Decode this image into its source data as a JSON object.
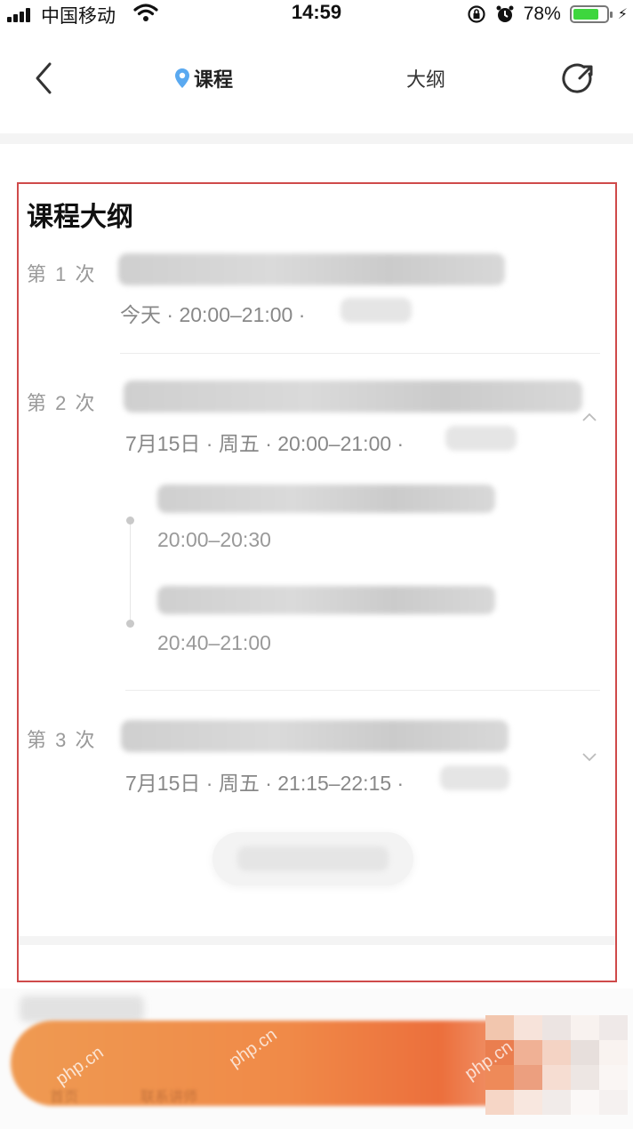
{
  "status_bar": {
    "carrier": "中国移动",
    "time": "14:59",
    "battery_percent": "78%",
    "battery_level": 0.78,
    "battery_color": "#3ed63e"
  },
  "nav": {
    "tab_course": "课程",
    "tab_outline": "大纲",
    "location_icon_color": "#5aa9f0"
  },
  "outline": {
    "title": "课程大纲",
    "lessons": [
      {
        "index": "第 1 次",
        "meta": "今天 · 20:00–21:00 ·"
      },
      {
        "index": "第 2 次",
        "meta": "7月15日 · 周五 · 20:00–21:00 ·",
        "sub_sessions": [
          {
            "time": "20:00–20:30"
          },
          {
            "time": "20:40–21:00"
          }
        ]
      },
      {
        "index": "第 3 次",
        "meta": "7月15日 · 周五 · 21:15–22:15 ·"
      }
    ],
    "highlight_border_color": "#cf4a4a"
  },
  "bottom_bar": {
    "action_color": "#f08a48",
    "labels": [
      "首页",
      "联系讲师"
    ],
    "watermark": "php.cn"
  }
}
